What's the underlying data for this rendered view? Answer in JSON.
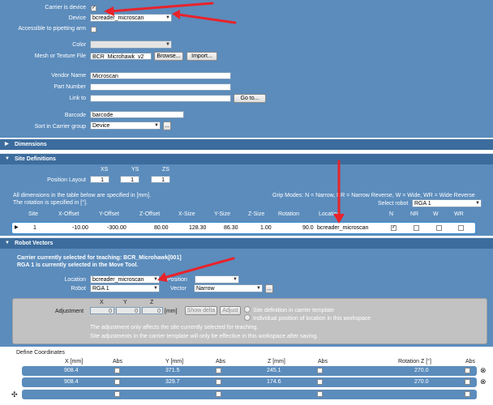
{
  "carrier": {
    "carrier_is_device_label": "Carrier is device",
    "device_label": "Device",
    "device_value": "bcreader_microscan",
    "accessible_label": "Accessible to pipetting arm",
    "color_label": "Color",
    "mesh_label": "Mesh or Texture File",
    "mesh_value": "BCR_Microhawk_v2",
    "browse_label": "Browse...",
    "import_label": "Import...",
    "vendor_name_label": "Vendor Name",
    "vendor_name_value": "Microscan",
    "part_number_label": "Part Number",
    "link_to_label": "Link to",
    "go_to_label": "Go to...",
    "barcode_label": "Barcode",
    "barcode_value": "barcode",
    "sort_label": "Sort in Carrier group",
    "sort_value": "Device",
    "sort_btn": "..."
  },
  "dimensions_header": "Dimensions",
  "site_definitions": {
    "header": "Site Definitions",
    "position_layout_label": "Position Layout",
    "xs_label": "XS",
    "ys_label": "YS",
    "zs_label": "ZS",
    "xs_value": "1",
    "ys_value": "1",
    "zs_value": "1",
    "note1": "All dimensions in the table below are specified in [mm].",
    "note2": "The rotation is specified in [°].",
    "grip_modes": "Grip Modes: N = Narrow, NR = Narrow Reverse, W = Wide, WR = Wide Reverse",
    "select_robot_label": "Select robot",
    "select_robot_value": "RGA 1",
    "columns": [
      "Site",
      "X-Offset",
      "Y-Offset",
      "Z-Offset",
      "X-Size",
      "Y-Size",
      "Z-Size",
      "Rotation",
      "Location",
      "N",
      "NR",
      "W",
      "WR"
    ],
    "row": [
      "1",
      "-10.00",
      "-300.00",
      "80.00",
      "128.30",
      "86.30",
      "1.00",
      "90.0",
      "bcreader_microscan"
    ]
  },
  "robot_vectors": {
    "header": "Robot Vectors",
    "info1": "Carrier currently selected for teaching: BCR_Microhawk[001]",
    "info2": "RGA 1 is currently selected in the Move Tool.",
    "location_label": "Location",
    "location_value": "bcreader_microscan",
    "position_label": "Position",
    "robot_label": "Robot",
    "robot_value": "RGA 1",
    "vector_label": "Vector",
    "vector_value": "Narrow",
    "vector_btn": "...",
    "adj_x": "X",
    "adj_y": "Y",
    "adj_z": "Z",
    "adjustment_label": "Adjustment",
    "adj_x_value": "0",
    "adj_y_value": "0",
    "adj_z_value": "0",
    "mm_label": "[mm]",
    "show_delta": "Show delta",
    "adjust": "Adjust",
    "radio1": "Site definition in carrier template",
    "radio2": "Individual position of location in this workspace",
    "adj_note1": "The adjustment only affects the site currently selected for teaching.",
    "adj_note2": "Site adjustments in the carrier template will only be effective in this workspace after saving.",
    "define_coords": "Define Coordinates",
    "coord_cols": [
      "X [mm]",
      "Abs",
      "Y [mm]",
      "Abs",
      "Z [mm]",
      "Abs",
      "Rotation Z [°]",
      "Abs"
    ],
    "coord_rows": [
      [
        "908.4",
        "371.5",
        "245.1",
        "270.0"
      ],
      [
        "908.4",
        "329.7",
        "174.6",
        "270.0"
      ]
    ]
  },
  "colors": {
    "panel": "#5b8cbc",
    "header": "#3c6c9d",
    "arrow": "#e8232b"
  }
}
